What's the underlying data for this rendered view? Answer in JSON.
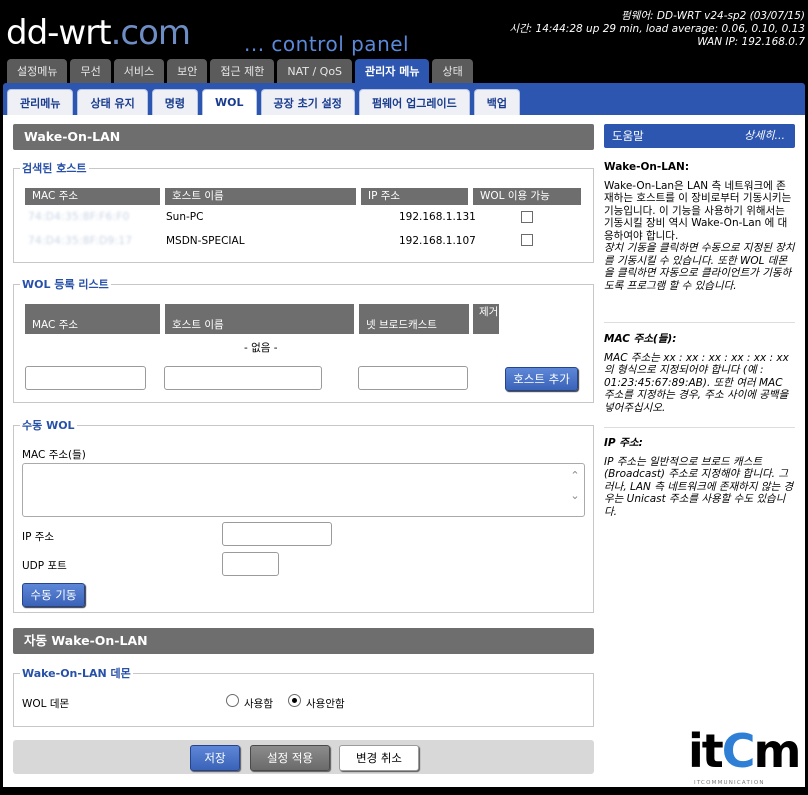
{
  "logo": {
    "main": "dd-wrt",
    "suffix": ".com",
    "subtitle": "... control panel"
  },
  "sysinfo": {
    "firmware": "펌웨어: DD-WRT v24-sp2 (03/07/15)",
    "time": "시간: 14:44:28 up 29 min, load average: 0.06, 0.10, 0.13",
    "wan_ip": "WAN IP: 192.168.0.7"
  },
  "main_tabs": [
    "설정메뉴",
    "무선",
    "서비스",
    "보안",
    "접근 제한",
    "NAT / QoS",
    "관리자 메뉴",
    "상태"
  ],
  "sub_tabs": [
    "관리메뉴",
    "상태 유지",
    "명령",
    "WOL",
    "공장 초기 설정",
    "펌웨어 업그레이드",
    "백업"
  ],
  "wol_title": "Wake-On-LAN",
  "discovered": {
    "legend": "검색된 호스트",
    "headers": [
      "MAC 주소",
      "호스트 이름",
      "IP 주소",
      "WOL 이용 가능"
    ],
    "rows": [
      {
        "mac": "74:D4:35:8F:F6:F0",
        "host": "Sun-PC",
        "ip": "192.168.1.131"
      },
      {
        "mac": "74:D4:35:8F:D9:17",
        "host": "MSDN-SPECIAL",
        "ip": "192.168.1.107"
      }
    ]
  },
  "registered": {
    "legend": "WOL 등록 리스트",
    "headers": [
      "MAC 주소",
      "호스트 이름",
      "넷 브로드캐스트",
      "제거"
    ],
    "empty": "- 없음 -",
    "add_button": "호스트 추가"
  },
  "manual": {
    "legend": "수동 WOL",
    "mac_label": "MAC 주소(들)",
    "ip_label": "IP 주소",
    "udp_label": "UDP 포트",
    "start_button": "수동 기동"
  },
  "auto_title": "자동 Wake-On-LAN",
  "daemon": {
    "legend": "Wake-On-LAN 데몬",
    "label": "WOL 데몬",
    "option_on": "사용함",
    "option_off": "사용안함",
    "selected": "off"
  },
  "buttons": {
    "save": "저장",
    "apply": "설정 적용",
    "cancel": "변경 취소"
  },
  "help": {
    "header": "도움말",
    "more": "상세히...",
    "sections": [
      {
        "title": "Wake-On-LAN:",
        "body": "Wake-On-Lan은 LAN 측 네트워크에 존재하는 호스트를 이 장비로부터 기동시키는 기능입니다. 이 기능을 사용하기 위해서는 기동시킬 장비 역시 Wake-On-Lan 에 대응하여야 합니다.",
        "body_italic": "장치 기동을 클릭하면 수동으로 지정된 장치를 기동시킬 수 있습니다. 또한 WOL 데몬 을 클릭하면 자동으로 클라이언트가 기동하도록 프로그램 할 수 있습니다."
      },
      {
        "title": "MAC 주소(들):",
        "body_italic": "MAC 주소는 xx : xx : xx : xx : xx : xx 의 형식으로 지정되어야 합니다 (예 : 01:23:45:67:89:AB). 또한 여러 MAC 주소를 지정하는 경우, 주소 사이에 공백을 넣어주십시오."
      },
      {
        "title": "IP 주소:",
        "body_italic": "IP 주소는 일반적으로 브로드 캐스트 (Broadcast) 주소로 지정해야 합니다. 그러나, LAN 측 네트워크에 존재하지 않는 경우는 Unicast 주소를 사용할 수도 있습니다."
      }
    ]
  },
  "watermark": {
    "text_a": "it",
    "text_b": "C",
    "text_c": "m",
    "sub": "ITCOMMUNICATION"
  },
  "colors": {
    "accent": "#2d56b0",
    "section_bar": "#6e6e6e",
    "header_bg": "#000000"
  }
}
